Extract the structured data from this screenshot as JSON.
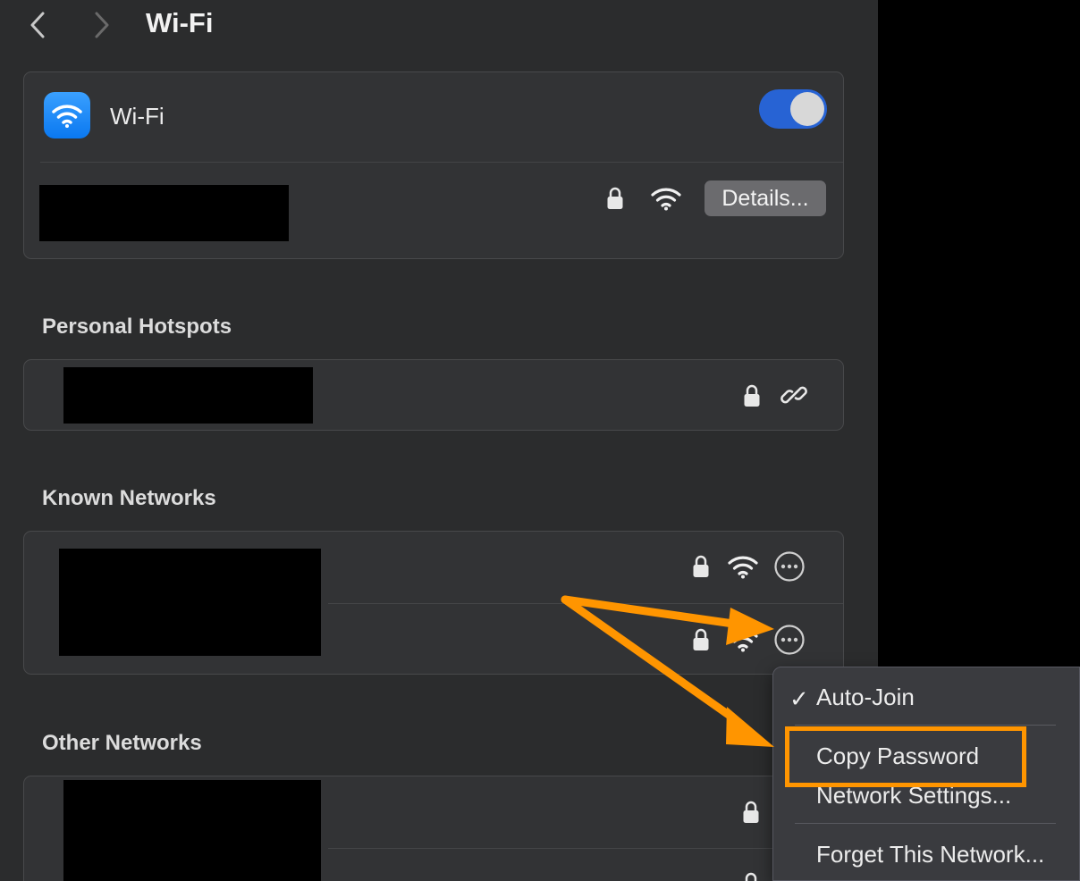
{
  "header": {
    "title": "Wi-Fi"
  },
  "wifi": {
    "label": "Wi-Fi",
    "toggle_on": true,
    "details_label": "Details..."
  },
  "sections": {
    "personal_hotspots": "Personal Hotspots",
    "known_networks": "Known Networks",
    "other_networks": "Other Networks"
  },
  "context_menu": {
    "items": [
      "Auto-Join",
      "Copy Password",
      "Network Settings...",
      "Forget This Network..."
    ],
    "checked": "Auto-Join",
    "highlighted": "Copy Password"
  },
  "icons": {
    "back": "chevron-left-icon",
    "forward": "chevron-right-icon",
    "lock": "lock-icon",
    "wifi": "wifi-icon",
    "hotspot": "link-icon",
    "more": "ellipsis-circle-icon"
  },
  "colors": {
    "accent": "#2763d4",
    "annotation": "#ff9500",
    "panel": "#2b2c2d"
  }
}
